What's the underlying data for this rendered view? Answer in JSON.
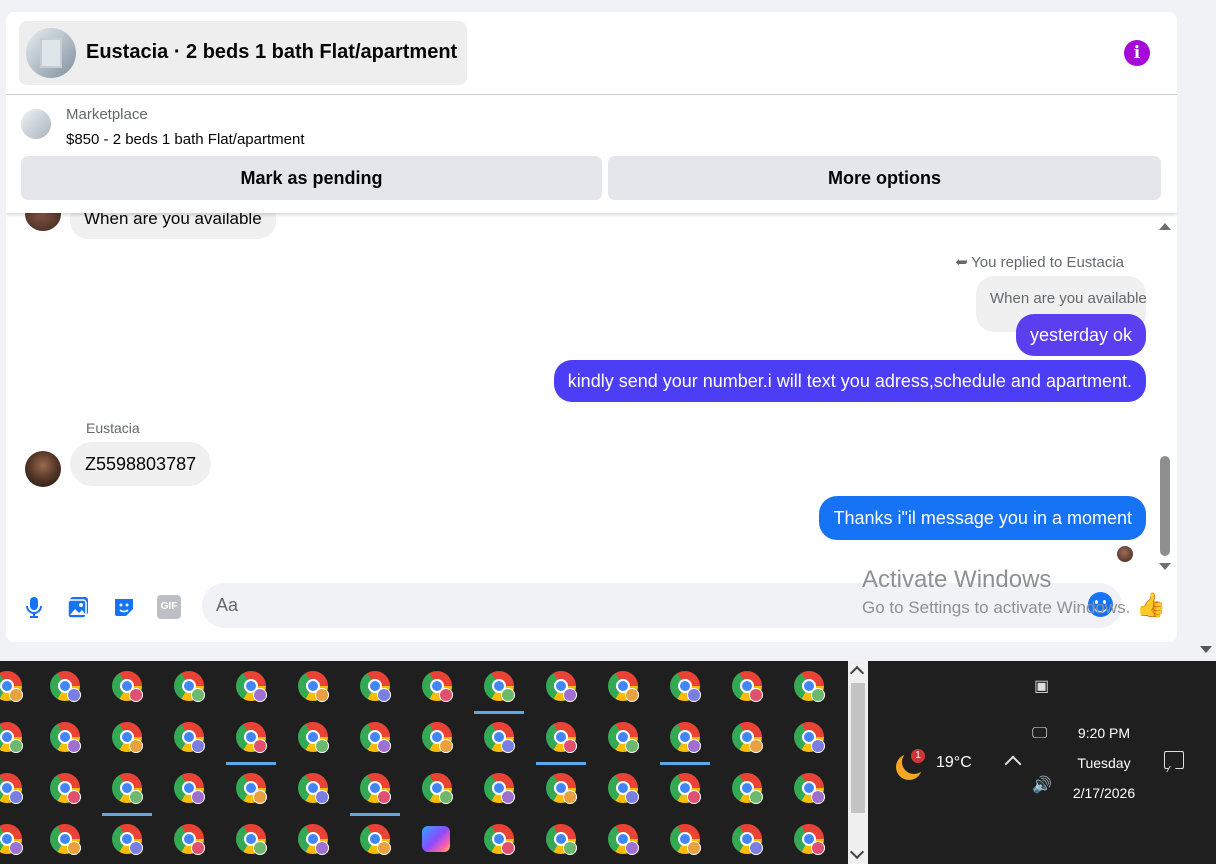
{
  "header": {
    "title": "Eustacia · 2 beds 1 bath Flat/apartment",
    "info_icon": "info-icon",
    "accent_color": "#a40bd6"
  },
  "marketplace": {
    "label": "Marketplace",
    "listing": "$850 - 2 beds 1 bath Flat/apartment",
    "buttons": {
      "pending": "Mark as pending",
      "more": "More options"
    }
  },
  "chat": {
    "partial_message": "When are you available",
    "reply_note": "You replied to Eustacia",
    "quoted_message": "When are you available",
    "outgoing": [
      {
        "text": "yesterday ok",
        "color": "#5b3ef0"
      },
      {
        "text": "kindly send your number.i will text you adress,schedule and apartment.",
        "color": "#4b3ef6"
      },
      {
        "text": "Thanks i\"il message you in a moment",
        "color": "#1673f5"
      }
    ],
    "sender_name": "Eustacia",
    "incoming": "Z5598803787"
  },
  "composer": {
    "placeholder": "Aa",
    "icons": [
      "microphone-icon",
      "photo-icon",
      "sticker-icon",
      "gif-icon",
      "emoji-icon",
      "thumbs-up-icon"
    ],
    "gif_label": "GIF"
  },
  "watermark": {
    "line1": "Activate Windows",
    "line2": "Go to Settings to activate Windows."
  },
  "taskbar": {
    "weather_badge": "1",
    "temperature": "19°C",
    "time": "9:20 PM",
    "day": "Tuesday",
    "date": "2/17/2026"
  },
  "tray": {
    "badge_colors": [
      "#e8a040",
      "#7a7ee0",
      "#e05070",
      "#6cb86c",
      "#a070d0"
    ]
  }
}
